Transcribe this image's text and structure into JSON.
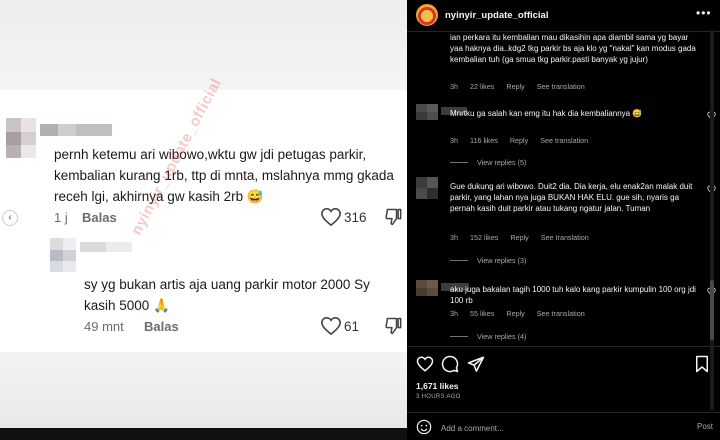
{
  "post": {
    "username": "nyinyir_update_official",
    "likes": "1,671 likes",
    "time_ago": "3 HOURS AGO"
  },
  "media": {
    "watermark": "nyinyir_update_official",
    "comments": [
      {
        "text": "pernh ketemu ari wibowo,wktu gw jdi petugas parkir, kembalian kurang 1rb, ttp di mnta, mslahnya mmg gkada receh lgi, akhirnya gw kasih 2rb 😅",
        "time": "1 j",
        "reply": "Balas",
        "likes": "316"
      },
      {
        "text": "sy yg bukan artis aja uang parkir motor 2000 Sy kasih 5000 🙏",
        "time": "49 mnt",
        "reply": "Balas",
        "likes": "61"
      }
    ]
  },
  "comments": [
    {
      "text": "ian perkara itu kembalian mau dikasihin apa diambil sama yg bayar yaa haknya dia..kdg2 tkg parkir bs aja klo yg \"nakal\" kan modus gada kembalian tuh (ga smua tkg parkir.pasti banyak yg jujur)",
      "time": "3h",
      "likes": "22 likes",
      "reply": "Reply",
      "see_translation": "See translation"
    },
    {
      "text": "Mnrtku ga salah kan emg itu hak dia kembaliannya 😅",
      "time": "3h",
      "likes": "116 likes",
      "reply": "Reply",
      "see_translation": "See translation",
      "view_replies": "View replies (5)"
    },
    {
      "text": "Gue dukung ari wibowo. Duit2 dia. Dia kerja, elu enak2an malak duit parkir, yang lahan nya juga BUKAN HAK ELU. gue sih, nyaris ga pernah kasih duit parkir atau tukang ngatur jalan. Tuman",
      "time": "3h",
      "likes": "152 likes",
      "reply": "Reply",
      "see_translation": "See translation",
      "view_replies": "View replies (3)"
    },
    {
      "text": "aku juga bakalan tagih 1000 tuh kalo kang parkir kumpulin 100 org jdi 100 rb",
      "time": "3h",
      "likes": "55 likes",
      "reply": "Reply",
      "see_translation": "See translation",
      "view_replies": "View replies (4)"
    }
  ],
  "add_comment": {
    "placeholder": "Add a comment...",
    "post_label": "Post"
  },
  "icons": {
    "like": "heart-icon",
    "comment": "comment-icon",
    "share": "share-icon",
    "save": "bookmark-icon",
    "emoji": "emoji-icon",
    "more": "more-icon"
  },
  "colors": {
    "background": "#000000",
    "text_primary": "#f5f5f5",
    "text_secondary": "#a8a8a8",
    "divider": "#262626"
  }
}
